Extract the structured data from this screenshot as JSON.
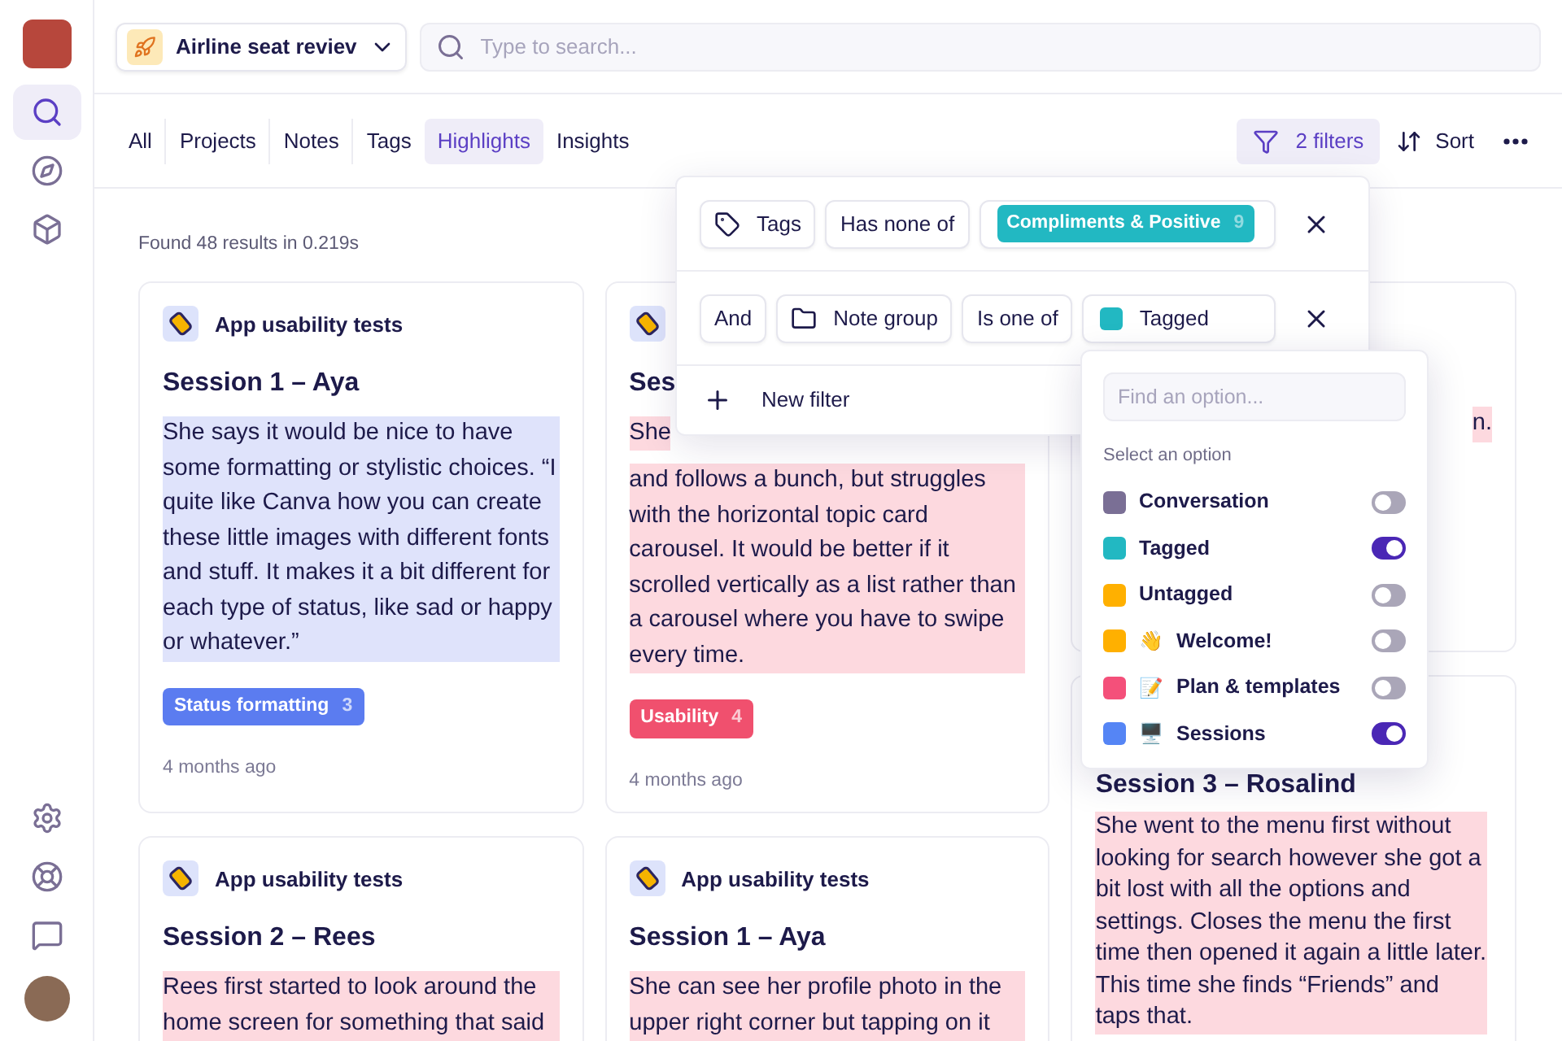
{
  "sidebar": {
    "items": [
      {
        "selected": true
      },
      {
        "selected": false
      },
      {
        "selected": false
      }
    ]
  },
  "project_picker": {
    "label": "Airline seat reviev"
  },
  "search": {
    "placeholder": "Type to search..."
  },
  "tabs": [
    {
      "label": "All",
      "selected": false
    },
    {
      "label": "Projects",
      "selected": false
    },
    {
      "label": "Notes",
      "selected": false
    },
    {
      "label": "Tags",
      "selected": false
    },
    {
      "label": "Highlights",
      "selected": true
    },
    {
      "label": "Insights",
      "selected": false
    }
  ],
  "toolbar": {
    "filters": "2 filters",
    "sort": "Sort"
  },
  "results_summary": "Found 48 results in 0.219s",
  "cards": [
    {
      "project": "App usability tests",
      "title": "Session 1 – Aya",
      "body": "She says it would be nice to have some formatting or stylistic choices. “I quite like Canva how you can create these little images with different fonts and stuff. It makes it a bit different for each type of status, like sad or happy or whatever.”",
      "color": "#dfe3fb",
      "tag": {
        "label": "Status formatting",
        "count": "3",
        "color": "#5b7cf0"
      },
      "time": "4 months ago"
    },
    {
      "title": "Ses",
      "lead": "She",
      "body": "and follows a bunch, but struggles with the horizontal topic card carousel. It would be better if it scrolled vertically as a list rather than a carousel where you have to swipe every time.",
      "color": "#fdd9df",
      "tag": {
        "label": "Usability",
        "count": "4",
        "color": "#f0506e"
      },
      "time": "4 months ago"
    },
    {
      "body": "n.",
      "color": "#fdd9df"
    },
    {
      "project": "App usability tests",
      "title": "Session 2 – Rees",
      "body": "Rees first started to look around the home screen for something that said",
      "color": "#fdd9df"
    },
    {
      "project": "App usability tests",
      "title": "Session 1 – Aya",
      "body": "She can see her profile photo in the upper right corner but tapping on it",
      "color": "#fdd9df"
    },
    {
      "title": "Session 3 – Rosalind",
      "body": "She went to the menu first without looking for search however she got a bit lost with all the options and settings. Closes the menu the first time then opened it again a little later. This time she finds “Friends” and taps that.",
      "color": "#fdd9df"
    }
  ],
  "filter_panel": {
    "rows": [
      {
        "chips": [
          {
            "kind": "field",
            "label": "Tags"
          },
          {
            "kind": "plain",
            "label": "Has none of"
          },
          {
            "kind": "tag",
            "label": "Compliments & Positive",
            "count": "9",
            "color": "#22b8c2"
          }
        ]
      },
      {
        "chips": [
          {
            "kind": "plain",
            "label": "And"
          },
          {
            "kind": "field",
            "label": "Note group"
          },
          {
            "kind": "plain",
            "label": "Is one of"
          },
          {
            "kind": "swatch",
            "label": "Tagged",
            "color": "#22b8c2"
          }
        ]
      }
    ],
    "new_filter": "New filter"
  },
  "option_menu": {
    "placeholder": "Find an option...",
    "heading": "Select an option",
    "options": [
      {
        "label": "Conversation",
        "color": "#7a6f95",
        "on": false
      },
      {
        "label": "Tagged",
        "color": "#22b8c2",
        "on": true
      },
      {
        "label": "Untagged",
        "color": "#ffb000",
        "on": false
      },
      {
        "emoji": "👋",
        "label": "Welcome!",
        "color": "#ffb000",
        "on": false
      },
      {
        "emoji": "📝",
        "label": "Plan & templates",
        "color": "#f4507a",
        "on": false
      },
      {
        "emoji": "🖥️",
        "label": "Sessions",
        "color": "#5585f5",
        "on": true
      }
    ]
  }
}
